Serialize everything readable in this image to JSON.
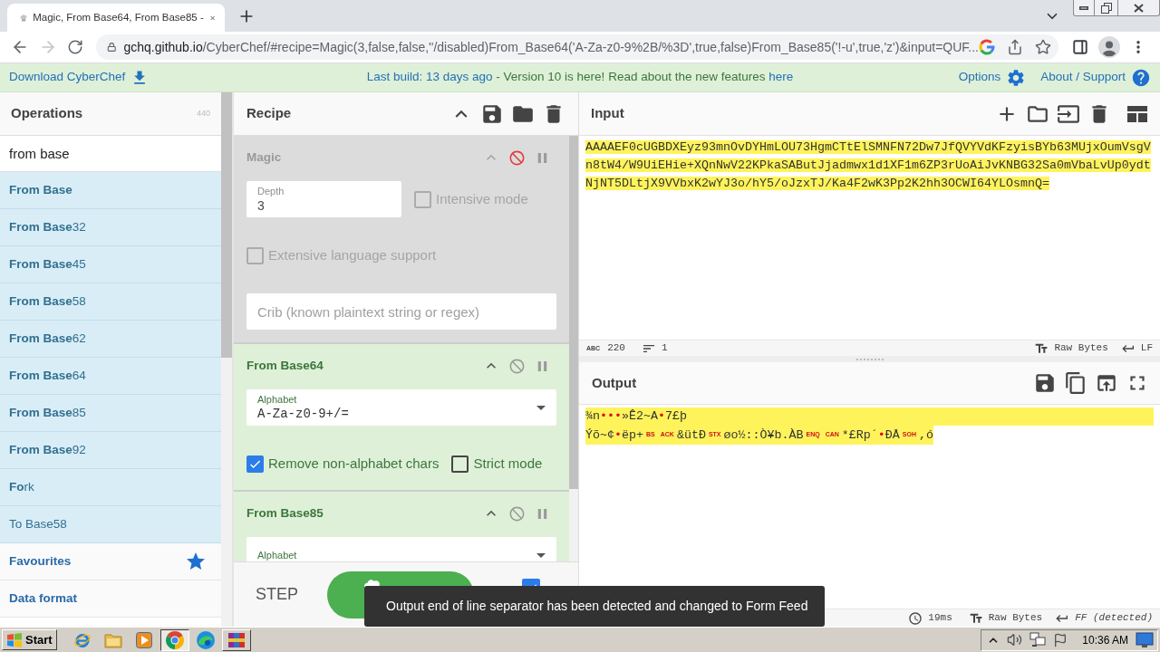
{
  "browser": {
    "tab": {
      "title": "Magic, From Base64, From Base85 -"
    },
    "address": {
      "host": "gchq.github.io",
      "rest": "/CyberChef/#recipe=Magic(3,false,false,''/disabled)From_Base64('A-Za-z0-9%2B/%3D',true,false)From_Base85('!-u',true,'z')&input=QUF..."
    }
  },
  "banner": {
    "download": "Download CyberChef",
    "notice": [
      {
        "kind": "link",
        "text": "Last build: 13 days ago"
      },
      {
        "kind": "text",
        "text": "- Version 10 is here! Read about the new features"
      },
      {
        "kind": "link",
        "text": "here"
      }
    ],
    "options": "Options",
    "about": "About / Support"
  },
  "operations": {
    "title": "Operations",
    "count": "440",
    "search": {
      "value": "from base"
    },
    "items": [
      {
        "label": "From Base",
        "bold": true
      },
      {
        "label": "**From Base**32",
        "bold": false
      },
      {
        "label": "**From Base**45",
        "bold": false
      },
      {
        "label": "**From Base**58",
        "bold": false
      },
      {
        "label": "**From Base**62",
        "bold": false
      },
      {
        "label": "**From Base**64",
        "bold": false
      },
      {
        "label": "**From Base**85",
        "bold": false
      },
      {
        "label": "**From Base**92",
        "bold": false
      },
      {
        "label": "**Fo**rk",
        "bold": false
      },
      {
        "label": "To Base58",
        "bold": false
      }
    ],
    "categories": [
      {
        "kind": "favourites",
        "label": "Favourites"
      },
      {
        "kind": "category",
        "label": "Data format"
      }
    ]
  },
  "recipe": {
    "title": "Recipe",
    "operations": [
      {
        "name": "Magic",
        "disabled": true,
        "args": [
          {
            "kind": "number",
            "label": "Depth",
            "value": "3"
          },
          {
            "kind": "checkbox",
            "label": "Intensive mode",
            "checked": false
          },
          {
            "kind": "checkbox",
            "label": "Extensive language support",
            "checked": false
          },
          {
            "kind": "text",
            "placeholder": "Crib (known plaintext string or regex)"
          }
        ]
      },
      {
        "name": "From Base64",
        "disabled": false,
        "args": [
          {
            "kind": "select",
            "label": "Alphabet",
            "value": "A-Za-z0-9+/="
          },
          {
            "kind": "checkbox",
            "label": "Remove non-alphabet chars",
            "checked": true
          },
          {
            "kind": "checkbox",
            "label": "Strict mode",
            "checked": false
          }
        ]
      },
      {
        "name": "From Base85",
        "disabled": false,
        "args": [
          {
            "kind": "select",
            "label": "Alphabet"
          }
        ]
      }
    ],
    "step": "STEP",
    "auto_bake": {
      "checked": true
    }
  },
  "input": {
    "title": "Input",
    "text": "AAAAEF0cUGBDXEyz93mnOvDYHmLOU73HgmCTtElSMNFN72Dw7JfQVYVdKFzyisBYb63MUjxOumVsgVn8tW4/W9UiEHie+XQnNwV22KPkaSAButJjadmwx1d1XF1m6ZP3rUoAiJvKNBG32Sa0mVbaLvUp0ydtNjNT5DLtjX9VVbxK2wYJ3o/hY5/oJzxTJ/Ka4F2wK3Pp2K2hh3OCWI64YLOsmnQ=",
    "length_symbol": "ABC",
    "length": "220",
    "lines": "1",
    "format": "Raw Bytes",
    "eol": "LF"
  },
  "output": {
    "title": "Output",
    "lines": [
      {
        "segments": [
          {
            "kind": "text",
            "text": "¾n"
          },
          {
            "kind": "symbol",
            "text": "•••"
          },
          {
            "kind": "text",
            "text": "»Ê2~A"
          },
          {
            "kind": "symbol",
            "text": "•"
          },
          {
            "kind": "text",
            "text": "7£þ"
          }
        ]
      },
      {
        "segments": [
          {
            "kind": "text",
            "text": "Ýõ~¢"
          },
          {
            "kind": "symbol",
            "text": "•"
          },
          {
            "kind": "text",
            "text": "ëp+"
          },
          {
            "kind": "control",
            "text": "BS"
          },
          {
            "kind": "control",
            "text": "ACK"
          },
          {
            "kind": "text",
            "text": "&ütÐ"
          },
          {
            "kind": "control",
            "text": "STX"
          },
          {
            "kind": "text",
            "text": "øo½::Ò¥b.ÀB"
          },
          {
            "kind": "control",
            "text": "ENQ"
          },
          {
            "kind": "control",
            "text": "CAN"
          },
          {
            "kind": "text",
            "text": "*£Rp´"
          },
          {
            "kind": "symbol",
            "text": "•"
          },
          {
            "kind": "text",
            "text": "ÐÅ"
          },
          {
            "kind": "control",
            "text": "SOH"
          },
          {
            "kind": "text",
            "text": ",ó"
          }
        ]
      }
    ],
    "time": "19ms",
    "format": "Raw Bytes",
    "eol": "FF (detected)"
  },
  "toast": {
    "message": "Output end of line separator has been detected and changed to Form Feed"
  },
  "taskbar": {
    "start": "Start",
    "icons": [
      {
        "kind": "explorer",
        "open": false,
        "selected": false
      },
      {
        "kind": "folder",
        "open": false,
        "selected": false
      },
      {
        "kind": "player",
        "open": false,
        "selected": false
      },
      {
        "kind": "chrome",
        "open": true,
        "selected": true
      },
      {
        "kind": "edge",
        "open": false,
        "selected": false
      },
      {
        "kind": "archiver",
        "open": true,
        "selected": false
      }
    ],
    "clock": "10:36 AM"
  }
}
